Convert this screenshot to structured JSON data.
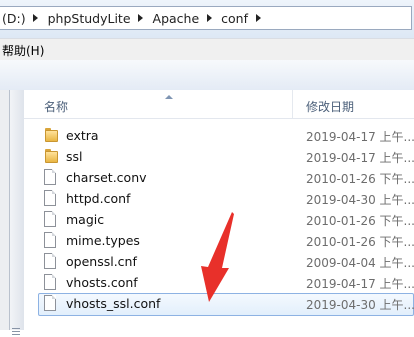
{
  "breadcrumb": {
    "segments": [
      "(D:)",
      "phpStudyLite",
      "Apache",
      "conf"
    ]
  },
  "menubar": {
    "items": [
      "帮助(H)"
    ]
  },
  "columns": {
    "name": "名称",
    "date": "修改日期"
  },
  "files": [
    {
      "name": "extra",
      "type": "folder",
      "date": "2019-04-17 上午..."
    },
    {
      "name": "ssl",
      "type": "folder",
      "date": "2019-04-17 上午..."
    },
    {
      "name": "charset.conv",
      "type": "file",
      "date": "2010-01-26 下午..."
    },
    {
      "name": "httpd.conf",
      "type": "file",
      "date": "2019-04-30 上午..."
    },
    {
      "name": "magic",
      "type": "file",
      "date": "2010-01-26 下午..."
    },
    {
      "name": "mime.types",
      "type": "file",
      "date": "2010-01-26 下午..."
    },
    {
      "name": "openssl.cnf",
      "type": "file",
      "date": "2009-04-04 上午..."
    },
    {
      "name": "vhosts.conf",
      "type": "file",
      "date": "2019-04-17 上午..."
    },
    {
      "name": "vhosts_ssl.conf",
      "type": "file",
      "date": "2019-04-30 上午...",
      "selected": true
    }
  ],
  "annotation_color": "#e8302a",
  "icons": {
    "folder": "folder-icon",
    "file": "file-icon"
  }
}
